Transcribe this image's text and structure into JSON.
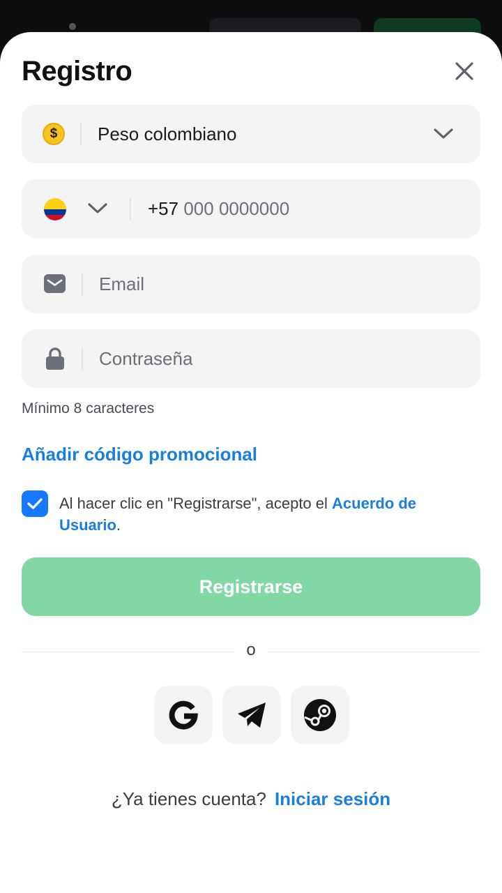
{
  "header": {
    "title": "Registro"
  },
  "currency": {
    "symbol": "$",
    "value": "Peso colombiano"
  },
  "phone": {
    "code": "+57",
    "placeholder": "000 0000000"
  },
  "email": {
    "placeholder": "Email"
  },
  "password": {
    "placeholder": "Contraseña",
    "hint": "Mínimo 8 caracteres"
  },
  "promo": {
    "label": "Añadir código promocional"
  },
  "terms": {
    "checked": true,
    "text": "Al hacer clic en \"Registrarse\", acepto el ",
    "link": "Acuerdo de Usuario",
    "end": "."
  },
  "register": {
    "label": "Registrarse"
  },
  "divider": {
    "label": "o"
  },
  "social": [
    "google-icon",
    "telegram-icon",
    "steam-icon"
  ],
  "footer": {
    "question": "¿Ya tienes cuenta?",
    "login": "Iniciar sesión"
  },
  "colors": {
    "accent": "#1a7ee0",
    "register_bg": "#82d8a5",
    "checkbox": "#1677ff",
    "field_bg": "#f4f4f5"
  }
}
